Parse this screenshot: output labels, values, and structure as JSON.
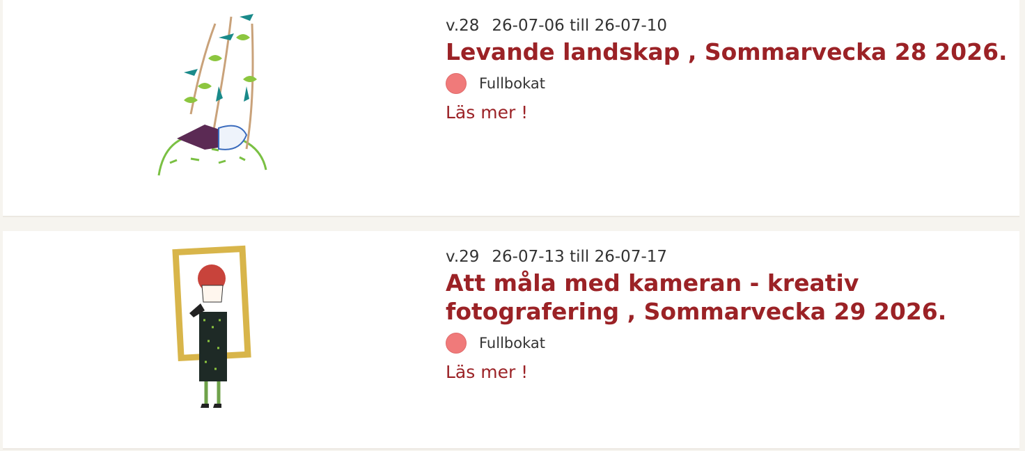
{
  "courses": [
    {
      "week": "v.28",
      "dates": "26-07-06 till 26-07-10",
      "title": "Levande landskap , Sommarvecka 28 2026.",
      "status": "Fullbokat",
      "status_color": "#f07a7a",
      "read_more": "Läs mer !",
      "illustration": "person-under-trees-with-birds-illustration"
    },
    {
      "week": "v.29",
      "dates": "26-07-13 till 26-07-17",
      "title": "Att måla med kameran - kreativ fotografering , Sommarvecka 29 2026.",
      "status": "Fullbokat",
      "status_color": "#f07a7a",
      "read_more": "Läs mer !",
      "illustration": "woman-holding-picture-frame-illustration"
    }
  ],
  "colors": {
    "accent": "#9b2226",
    "text": "#333333",
    "background": "#f6f4ef",
    "card": "#ffffff"
  }
}
